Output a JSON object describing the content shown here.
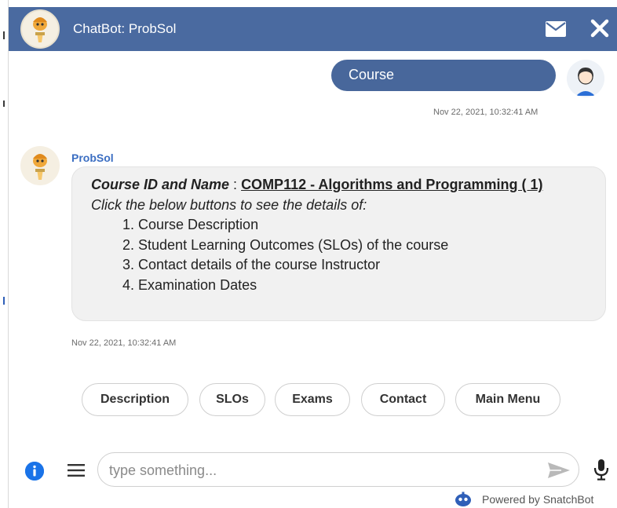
{
  "header": {
    "title": "ChatBot: ProbSol",
    "bg_color": "#4a6aa0",
    "icons": [
      "bot-avatar-icon",
      "mail-icon",
      "close-icon"
    ]
  },
  "conversation": {
    "user_message": {
      "text": "Course",
      "timestamp": "Nov 22, 2021, 10:32:41 AM",
      "bubble_color": "#48679b"
    },
    "bot_message": {
      "sender": "ProbSol",
      "label": "Course ID and Name",
      "separator": " : ",
      "course": "COMP112 - Algorithms and Programming ( 1)",
      "instruction": "Click the below buttons to see the details of:",
      "items": [
        "1. Course Description",
        "2. Student Learning Outcomes (SLOs) of the course",
        "3. Contact details of the course Instructor",
        "4. Examination Dates"
      ],
      "timestamp": "Nov 22, 2021, 10:32:41 AM"
    }
  },
  "quick_replies": [
    "Description",
    "SLOs",
    "Exams",
    "Contact",
    "Main Menu"
  ],
  "composer": {
    "placeholder": "type something...",
    "icons": [
      "info-icon",
      "menu-icon",
      "send-icon",
      "mic-icon"
    ]
  },
  "footer": {
    "powered_by": "Powered by SnatchBot"
  }
}
